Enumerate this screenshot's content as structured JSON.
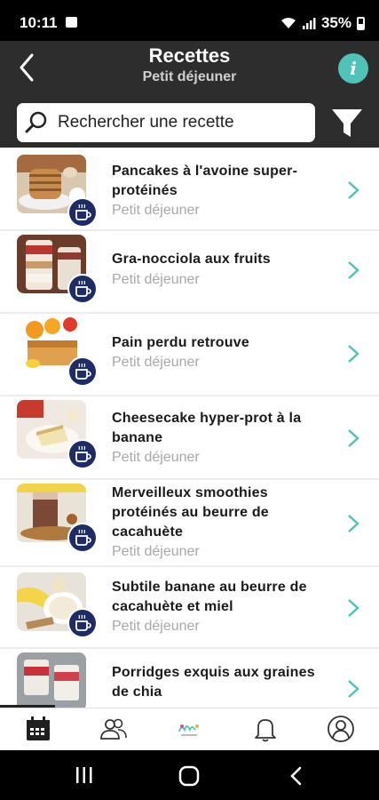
{
  "status": {
    "time": "10:11",
    "battery": "35%"
  },
  "header": {
    "title": "Recettes",
    "subtitle": "Petit déjeuner",
    "search_placeholder": "Rechercher une recette"
  },
  "recipes": [
    {
      "title": "Pancakes à l'avoine super-protéinés",
      "category": "Petit déjeuner"
    },
    {
      "title": "Gra-nocciola aux fruits",
      "category": "Petit déjeuner"
    },
    {
      "title": "Pain perdu retrouve",
      "category": "Petit déjeuner"
    },
    {
      "title": "Cheesecake hyper-prot à la banane",
      "category": "Petit déjeuner"
    },
    {
      "title": "Merveilleux smoothies protéinés au beurre de cacahuète",
      "category": "Petit déjeuner"
    },
    {
      "title": "Subtile banane au beurre de cacahuète et miel",
      "category": "Petit déjeuner"
    },
    {
      "title": "Porridges exquis aux graines de chia",
      "category": ""
    }
  ],
  "colors": {
    "accent": "#4fc3b7",
    "header_bg": "#2d2d2d",
    "badge": "#1d2c66"
  }
}
